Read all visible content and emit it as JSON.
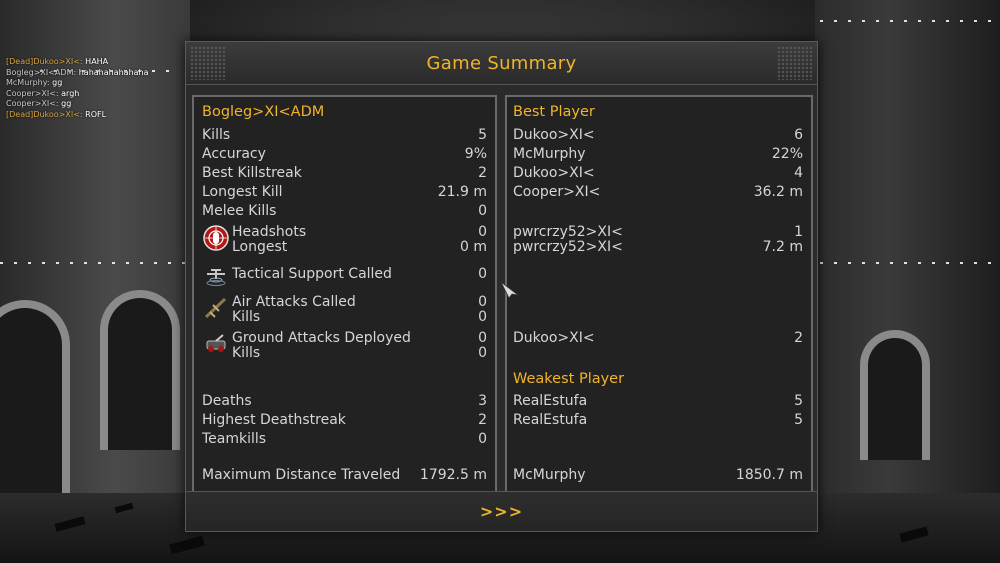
{
  "chat": [
    {
      "prefix": "[Dead]",
      "name": "Dukoo>XI<:",
      "msg": "HAHA"
    },
    {
      "prefix": "",
      "name": "Bogleg>XI<ADM:",
      "msg": "hahahahahahaha"
    },
    {
      "prefix": "",
      "name": "McMurphy:",
      "msg": "gg"
    },
    {
      "prefix": "",
      "name": "Cooper>XI<:",
      "msg": "argh"
    },
    {
      "prefix": "",
      "name": "Cooper>XI<:",
      "msg": "gg"
    },
    {
      "prefix": "[Dead]",
      "name": "Dukoo>XI<:",
      "msg": "ROFL"
    }
  ],
  "title": "Game Summary",
  "player": {
    "name": "Bogleg>XI<ADM",
    "kills_label": "Kills",
    "kills": "5",
    "accuracy_label": "Accuracy",
    "accuracy": "9%",
    "killstreak_label": "Best Killstreak",
    "killstreak": "2",
    "longest_kill_label": "Longest Kill",
    "longest_kill": "21.9 m",
    "melee_label": "Melee Kills",
    "melee": "0",
    "headshots_label": "Headshots",
    "headshots": "0",
    "hs_longest_label": "Longest",
    "hs_longest": "0 m",
    "tactical_label": "Tactical Support Called",
    "tactical": "0",
    "air_label": "Air Attacks Called",
    "air": "0",
    "air_kills_label": "Kills",
    "air_kills": "0",
    "ground_label": "Ground Attacks Deployed",
    "ground": "0",
    "ground_kills_label": "Kills",
    "ground_kills": "0",
    "deaths_label": "Deaths",
    "deaths": "3",
    "deathstreak_label": "Highest Deathstreak",
    "deathstreak": "2",
    "teamkills_label": "Teamkills",
    "teamkills": "0",
    "distance_label": "Maximum Distance Traveled",
    "distance": "1792.5 m"
  },
  "best": {
    "header": "Best Player",
    "kills": {
      "name": "Dukoo>XI<",
      "value": "6"
    },
    "accuracy": {
      "name": "McMurphy",
      "value": "22%"
    },
    "killstreak": {
      "name": "Dukoo>XI<",
      "value": "4"
    },
    "longest_kill": {
      "name": "Cooper>XI<",
      "value": "36.2 m"
    },
    "headshots": {
      "name": "pwrcrzy52>XI<",
      "value": "1"
    },
    "hs_longest": {
      "name": "pwrcrzy52>XI<",
      "value": "7.2 m"
    },
    "ground_kills": {
      "name": "Dukoo>XI<",
      "value": "2"
    },
    "distance": {
      "name": "McMurphy",
      "value": "1850.7 m"
    }
  },
  "weakest": {
    "header": "Weakest Player",
    "deaths": {
      "name": "RealEstufa",
      "value": "5"
    },
    "deathstreak": {
      "name": "RealEstufa",
      "value": "5"
    }
  },
  "footer": {
    "next_label": ">>>"
  },
  "colors": {
    "accent": "#f0b42a",
    "panel": "#2b2b2b",
    "text": "#d6d6d6"
  }
}
